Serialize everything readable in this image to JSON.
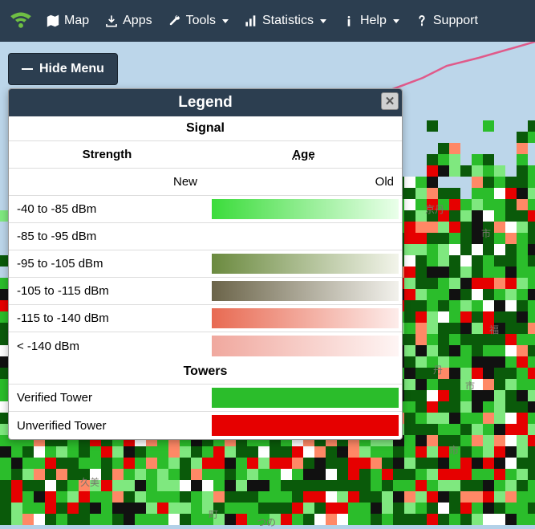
{
  "nav": {
    "map": "Map",
    "apps": "Apps",
    "tools": "Tools",
    "statistics": "Statistics",
    "help": "Help",
    "support": "Support"
  },
  "hide_menu_btn": "Hide Menu",
  "legend": {
    "title": "Legend",
    "signal_section": "Signal",
    "strength_header": "Strength",
    "age_header": "Age",
    "age_new": "New",
    "age_old": "Old",
    "signal_rows": [
      {
        "label": "-40 to -85 dBm",
        "cls": "grad-green"
      },
      {
        "label": "-85 to -95 dBm",
        "cls": ""
      },
      {
        "label": "-95 to -105 dBm",
        "cls": "grad-olive"
      },
      {
        "label": "-105 to -115 dBm",
        "cls": "grad-brown"
      },
      {
        "label": "-115 to -140 dBm",
        "cls": "grad-salmon"
      },
      {
        "label": "< -140 dBm",
        "cls": "grad-pink"
      }
    ],
    "towers_section": "Towers",
    "tower_rows": [
      {
        "label": "Verified Tower",
        "cls": "solid-green"
      },
      {
        "label": "Unverified Tower",
        "cls": "solid-red"
      }
    ]
  },
  "map_labels": [
    "京丹",
    "市",
    "丹",
    "市",
    "福",
    "市",
    "久美",
    "町",
    "つの"
  ],
  "colors": {
    "navbar": "#2c3e50",
    "water": "#bcd6ea",
    "mosaic": [
      "#0a5a0a",
      "#2bbd2b",
      "#7fe87f",
      "#e60000",
      "#ff8866",
      "#111111",
      "#ffffff"
    ]
  }
}
